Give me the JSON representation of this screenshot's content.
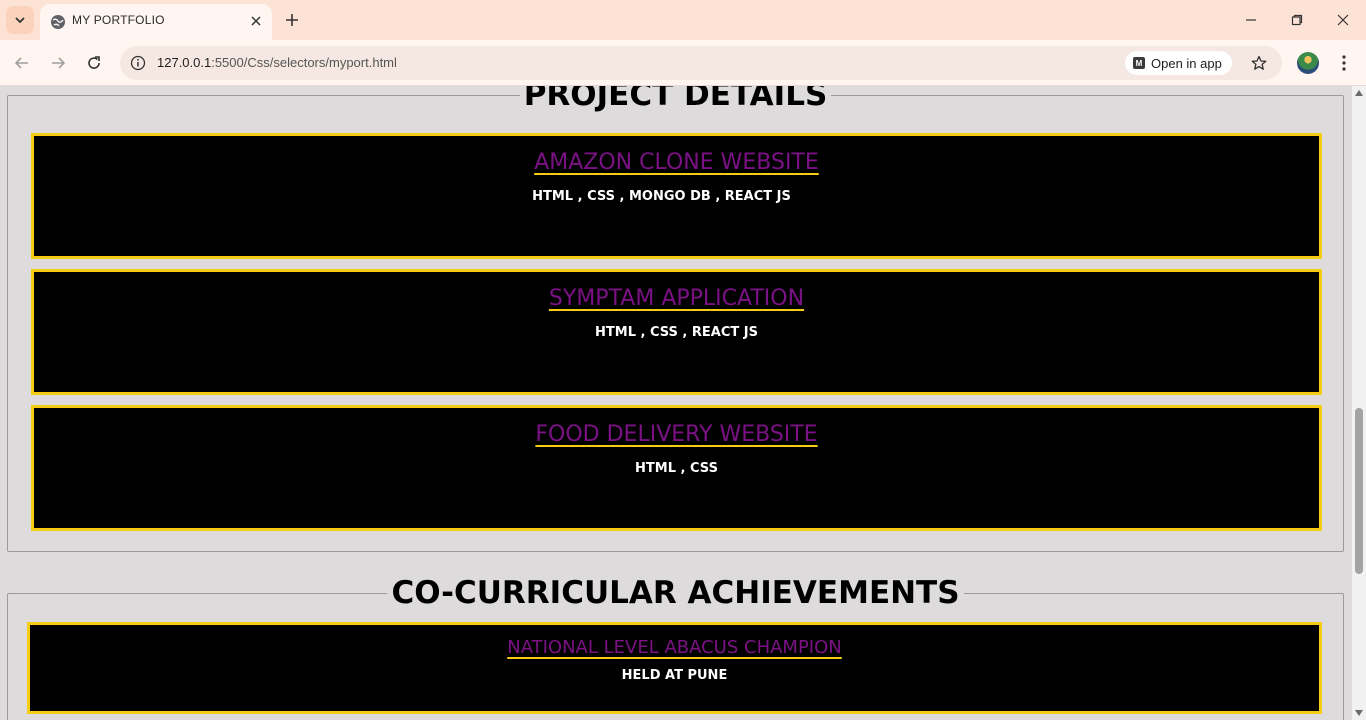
{
  "browser": {
    "tab_title": "MY PORTFOLIO",
    "url_host": "127.0.0.1",
    "url_rest": ":5500/Css/selectors/myport.html",
    "open_in_app_label": "Open in app"
  },
  "projects_section": {
    "heading": "PROJECT DETAILS",
    "items": [
      {
        "title": "AMAZON CLONE WEBSITE",
        "stack": "HTML , CSS , MONGO DB , REACT JS"
      },
      {
        "title": "SYMPTAM APPLICATION",
        "stack": "HTML , CSS , REACT JS"
      },
      {
        "title": "FOOD DELIVERY WEBSITE",
        "stack": "HTML , CSS"
      }
    ]
  },
  "cocurricular_section": {
    "heading": "CO-CURRICULAR ACHIEVEMENTS",
    "items": [
      {
        "title": "NATIONAL LEVEL ABACUS CHAMPION",
        "detail": "HELD AT PUNE"
      }
    ]
  },
  "colors": {
    "card_background": "#000000",
    "card_border": "#f7cd13",
    "card_title": "#7b1185",
    "page_background": "#dddbdc",
    "tabbar_background": "#fde3d5"
  }
}
